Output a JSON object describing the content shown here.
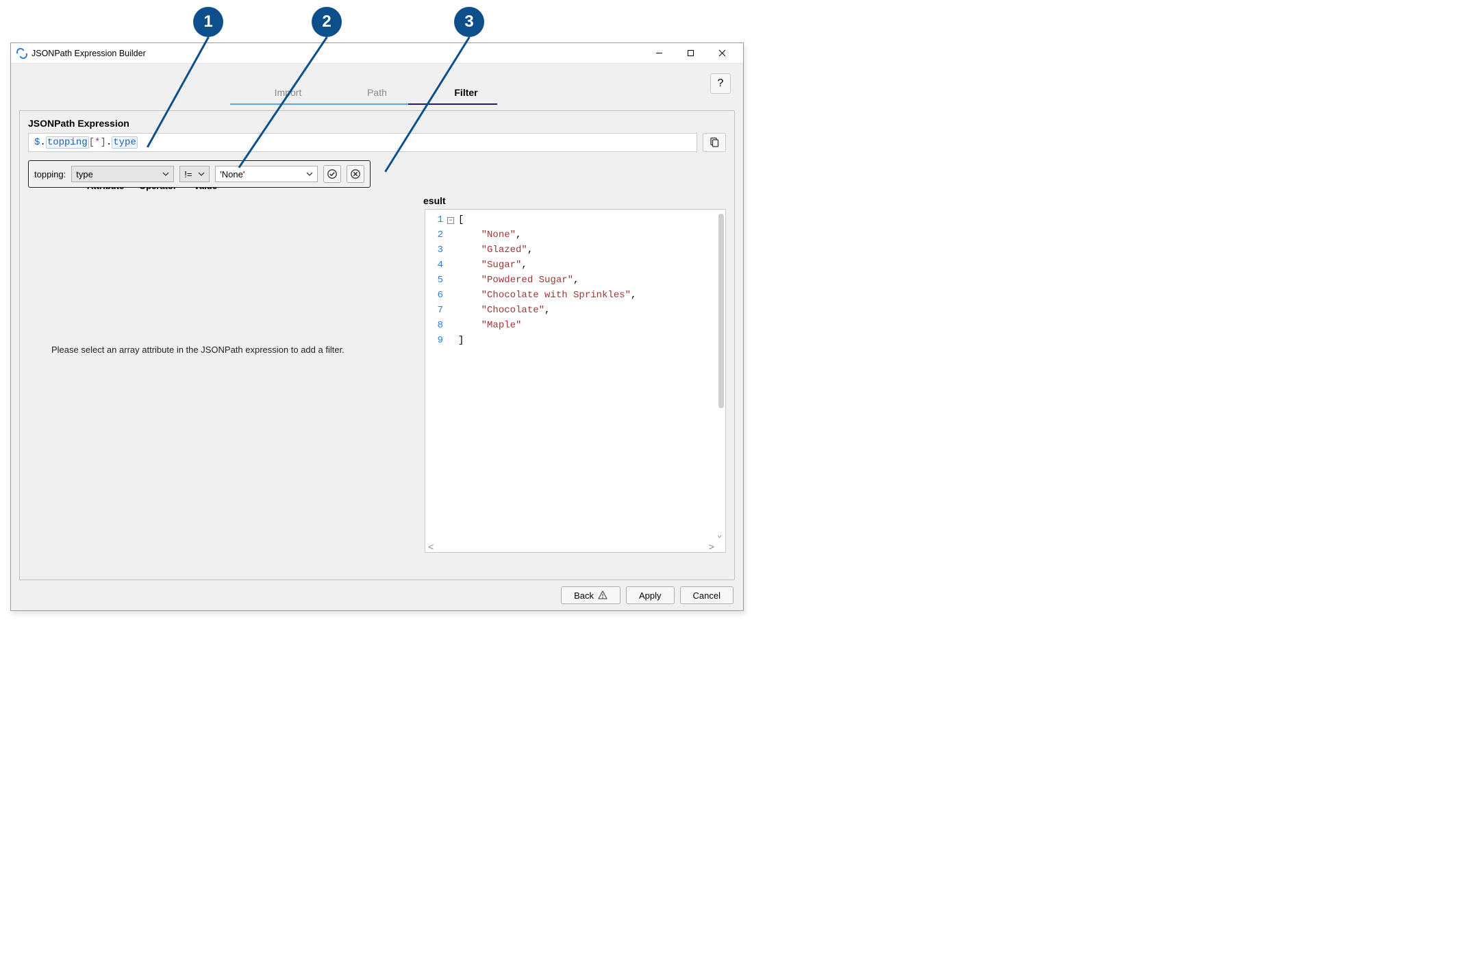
{
  "callouts": {
    "c1": "1",
    "c2": "2",
    "c3": "3"
  },
  "window": {
    "title": "JSONPath Expression Builder",
    "help": "?"
  },
  "tabs": {
    "import": "Import",
    "path": "Path",
    "filter": "Filter"
  },
  "section": {
    "title": "JSONPath Expression"
  },
  "expression": {
    "root": "$",
    "dot1": ".",
    "name1": "topping",
    "lb": "[",
    "star": "*",
    "rb": "]",
    "dot2": ".",
    "name2": "type"
  },
  "popup": {
    "label": "topping:",
    "attribute": "type",
    "operator": "!=",
    "value": "'None'"
  },
  "columns": {
    "attribute": "Attribute",
    "operator": "Operator",
    "value": "Value"
  },
  "hint": "Please select an array attribute in the JSONPath expression to add a filter.",
  "result": {
    "label": "esult",
    "lines": {
      "l1n": "1",
      "l2n": "2",
      "l3n": "3",
      "l4n": "4",
      "l5n": "5",
      "l6n": "6",
      "l7n": "7",
      "l8n": "8",
      "l9n": "9",
      "open": "[",
      "v1": "\"None\"",
      "c1": ",",
      "v2": "\"Glazed\"",
      "c2": ",",
      "v3": "\"Sugar\"",
      "c3": ",",
      "v4": "\"Powdered Sugar\"",
      "c4": ",",
      "v5": "\"Chocolate with Sprinkles\"",
      "c5": ",",
      "v6": "\"Chocolate\"",
      "c6": ",",
      "v7": "\"Maple\"",
      "close": "]"
    }
  },
  "footer": {
    "back": "Back",
    "apply": "Apply",
    "cancel": "Cancel"
  }
}
